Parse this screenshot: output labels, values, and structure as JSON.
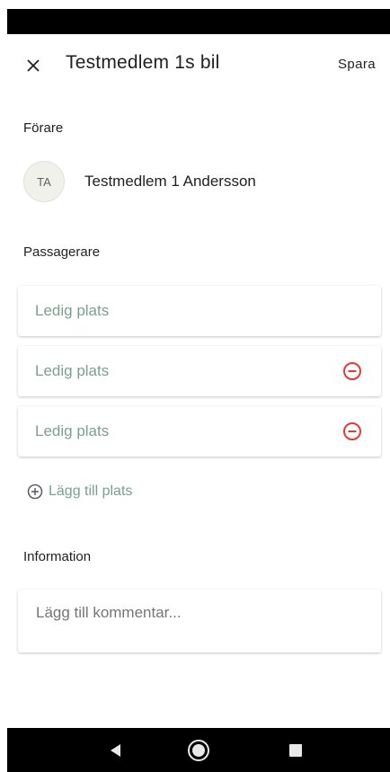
{
  "header": {
    "close_icon": "close-icon",
    "title": "Testmedlem 1s bil",
    "save_label": "Spara"
  },
  "driver_section": {
    "label": "Förare",
    "avatar_initials": "TA",
    "driver_name": "Testmedlem 1 Andersson"
  },
  "passenger_section": {
    "label": "Passagerare",
    "seats": [
      {
        "label": "Ledig plats",
        "removable": false
      },
      {
        "label": "Ledig plats",
        "removable": true
      },
      {
        "label": "Ledig plats",
        "removable": true
      }
    ],
    "remove_icon": "minus-circle-icon",
    "add_seat_icon": "plus-circle-icon",
    "add_seat_label": "Lägg till plats"
  },
  "information_section": {
    "label": "Information",
    "comment_placeholder": "Lägg till kommentar...",
    "comment_value": ""
  },
  "colors": {
    "accent": "#7aa090",
    "remove": "#e53935",
    "text": "#202124"
  },
  "nav_bar": {
    "back_icon": "back-triangle-icon",
    "home_icon": "home-circle-icon",
    "recent_icon": "recent-square-icon"
  }
}
